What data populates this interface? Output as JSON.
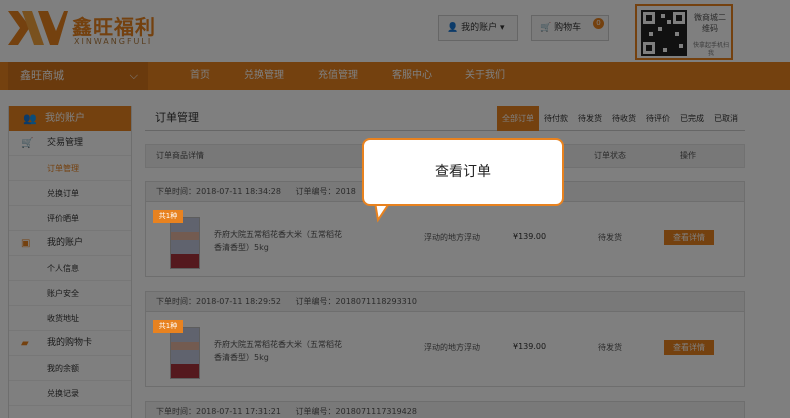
{
  "header": {
    "logo_text": "鑫旺福利",
    "logo_sub": "XINWANGFULI",
    "account_label": "我的账户",
    "cart_label": "购物车",
    "cart_count": "0",
    "qr_title": "微商城二维码",
    "qr_sub": "快拿起手机扫我"
  },
  "nav": {
    "store": "鑫旺商城",
    "items": [
      "首页",
      "兑换管理",
      "充值管理",
      "客服中心",
      "关于我们"
    ]
  },
  "sidebar": {
    "head": "我的账户",
    "sections": [
      {
        "label": "交易管理",
        "items": [
          "订单管理",
          "兑换订单",
          "评价晒单"
        ]
      },
      {
        "label": "我的账户",
        "items": [
          "个人信息",
          "账户安全",
          "收货地址"
        ]
      },
      {
        "label": "我的购物卡",
        "items": [
          "我的余额",
          "兑换记录"
        ]
      }
    ]
  },
  "main": {
    "title": "订单管理",
    "tabs": [
      "全部订单",
      "待付款",
      "待发货",
      "待收货",
      "待评价",
      "已完成",
      "已取消"
    ],
    "columns": {
      "detail": "订单商品详情",
      "status": "订单状态",
      "action": "操作"
    },
    "orders": [
      {
        "time_label": "下单时间：2018-07-11 18:34:28",
        "no_label": "订单编号：2018",
        "tag": "共1种",
        "name": "乔府大院五常稻花香大米（五常稻花香清香型）5kg",
        "shop": "浮动的地方浮动",
        "price": "¥139.00",
        "status": "待发货",
        "btn": "查看详情"
      },
      {
        "time_label": "下单时间：2018-07-11 18:29:52",
        "no_label": "订单编号：2018071118293310",
        "tag": "共1种",
        "name": "乔府大院五常稻花香大米（五常稻花香清香型）5kg",
        "shop": "浮动的地方浮动",
        "price": "¥139.00",
        "status": "待发货",
        "btn": "查看详情"
      },
      {
        "time_label": "下单时间：2018-07-11 17:31:21",
        "no_label": "订单编号：2018071117319428"
      }
    ]
  },
  "callout": "查看订单",
  "colors": {
    "accent": "#e8821f"
  }
}
